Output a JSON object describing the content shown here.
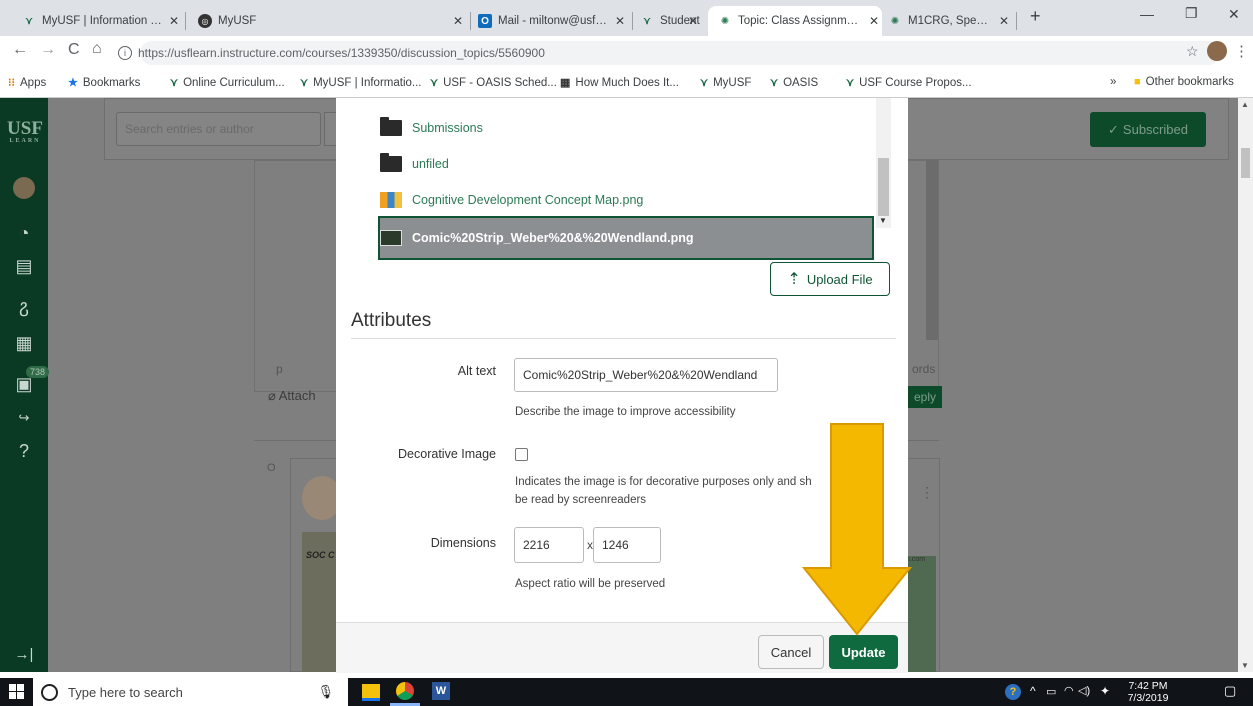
{
  "tabs": [
    {
      "title": "MyUSF | Information Te",
      "icon": "usf-bull-icon"
    },
    {
      "title": "MyUSF",
      "icon": "globe-icon"
    },
    {
      "title": "Mail - miltonw@usf.edu",
      "icon": "outlook-icon"
    },
    {
      "title": "Student",
      "icon": "usf-bull-icon"
    },
    {
      "title": "Topic: Class Assignment",
      "icon": "canvas-icon",
      "active": true
    },
    {
      "title": "M1CRG, SpeedGrader, ",
      "icon": "canvas-icon"
    }
  ],
  "url": "https://usflearn.instructure.com/courses/1339350/discussion_topics/5560900",
  "bookmarks": {
    "apps": "Apps",
    "items": [
      "Bookmarks",
      "Online Curriculum...",
      "MyUSF | Informatio...",
      "USF - OASIS Sched...",
      "How Much Does It...",
      "MyUSF",
      "OASIS",
      "USF Course Propos..."
    ],
    "more": "»",
    "other": "Other bookmarks"
  },
  "sidebar": {
    "logo": "USF",
    "logo_sub": "LEARN",
    "inbox_badge": "738"
  },
  "background": {
    "search_placeholder": "Search entries or author",
    "subscribed": "Subscribed",
    "paragraph_marker": "p",
    "attach": "Attach",
    "words": "ords",
    "reply": "eply",
    "soc": "SOC C",
    "com": "n.com",
    "circle_marker": "O"
  },
  "files": [
    {
      "name": "Submissions",
      "type": "folder"
    },
    {
      "name": "unfiled",
      "type": "folder"
    },
    {
      "name": "Cognitive Development Concept Map.png",
      "type": "image"
    },
    {
      "name": "Comic%20Strip_Weber%20&%20Wendland.png",
      "type": "image",
      "selected": true
    }
  ],
  "upload_label": "Upload File",
  "attributes": {
    "title": "Attributes",
    "alt_label": "Alt text",
    "alt_value": "Comic%20Strip_Weber%20&%20Wendland",
    "alt_hint": "Describe the image to improve accessibility",
    "decorative_label": "Decorative Image",
    "decorative_hint_1": "Indicates the image is for decorative purposes only and sh",
    "decorative_hint_2": "be read by screenreaders",
    "dimensions_label": "Dimensions",
    "width": "2216",
    "height": "1246",
    "times": "x",
    "aspect_hint": "Aspect ratio will be preserved"
  },
  "buttons": {
    "cancel": "Cancel",
    "update": "Update"
  },
  "taskbar": {
    "search_placeholder": "Type here to search",
    "time": "7:42 PM",
    "date": "7/3/2019"
  },
  "colors": {
    "canvas_green": "#0f6b3f",
    "arrow": "#f5b800",
    "sidebar": "#0b3a24"
  }
}
